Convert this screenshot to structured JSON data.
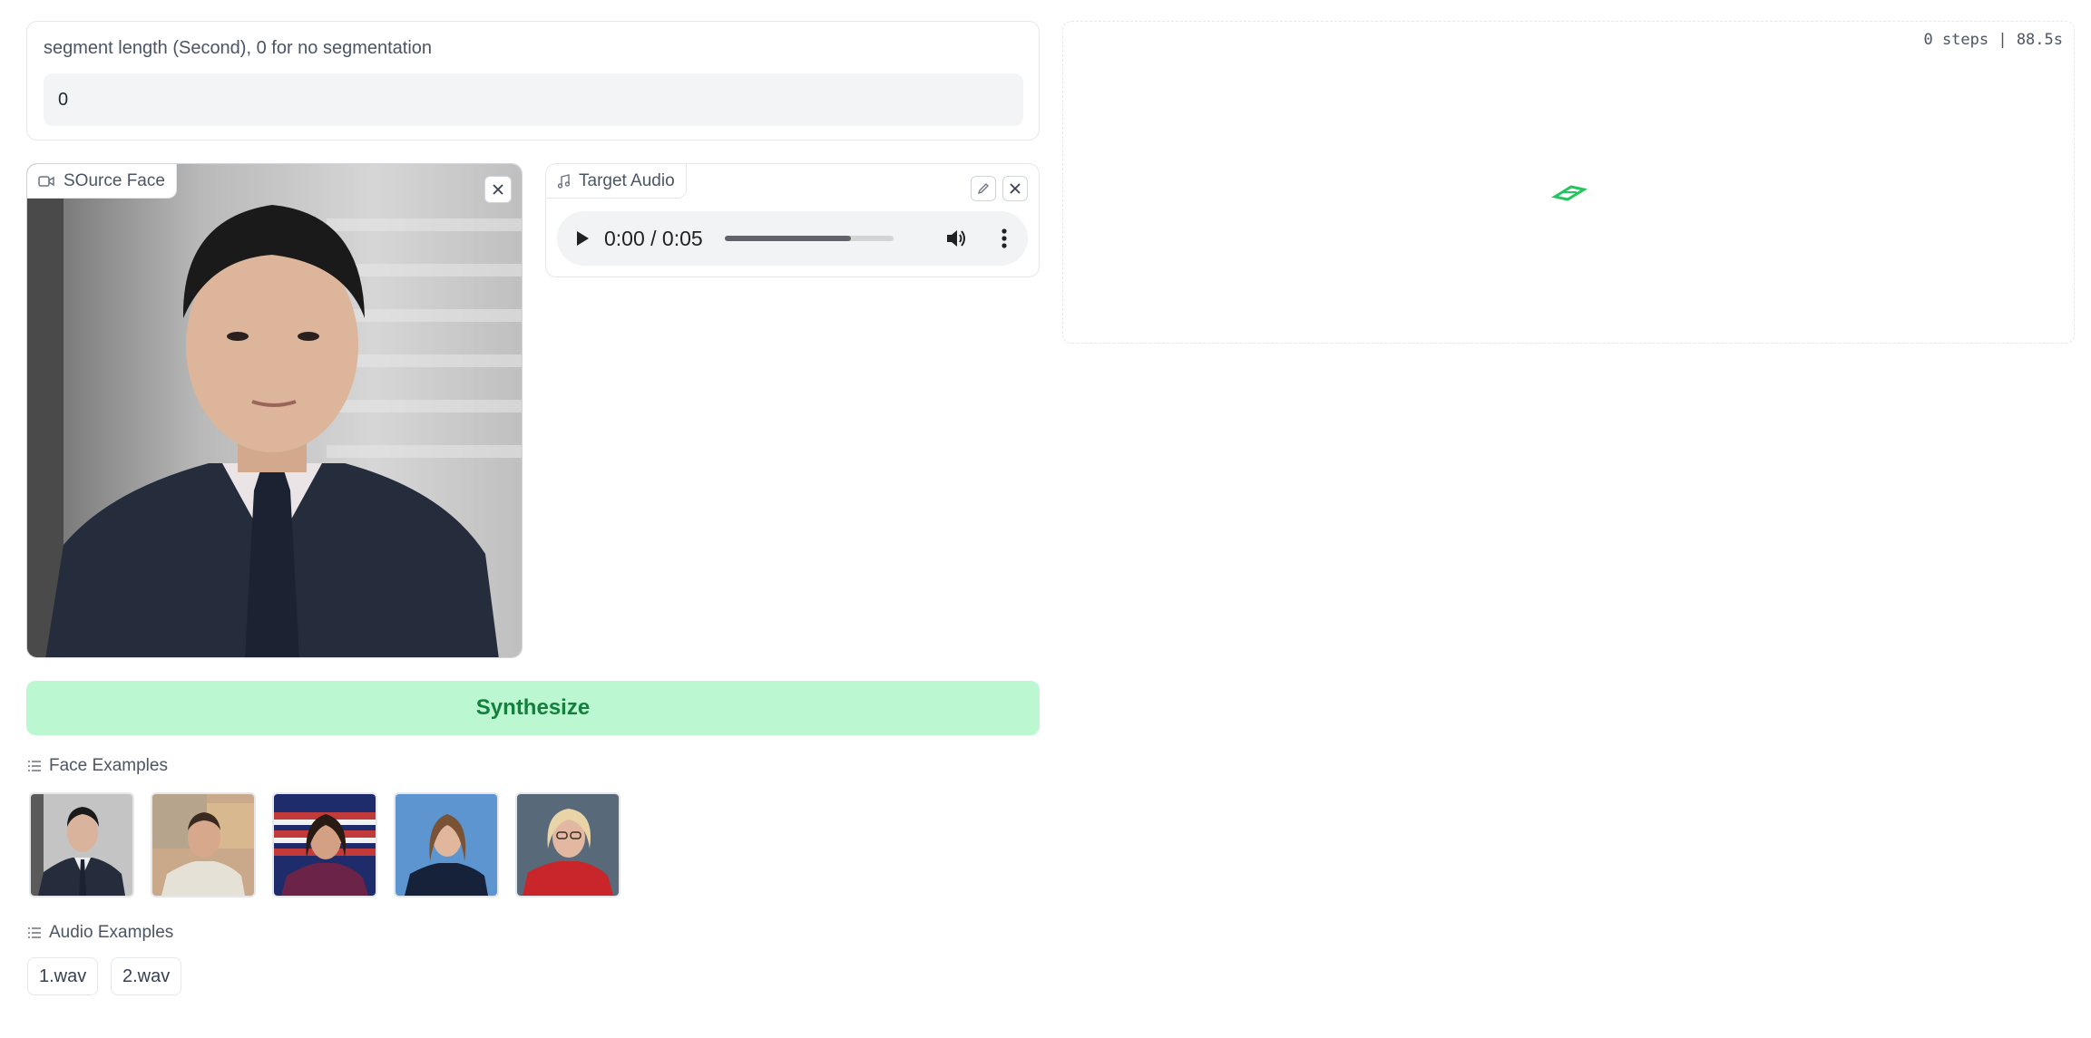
{
  "segment": {
    "label": "segment length (Second), 0 for no segmentation",
    "value": "0"
  },
  "source_face": {
    "label": "SOurce Face",
    "icon": "video-camera-icon",
    "close_icon": "close-icon"
  },
  "target_audio": {
    "label": "Target Audio",
    "icon": "music-note-icon",
    "time": "0:00 / 0:05",
    "progress": 0.75,
    "edit_icon": "pencil-icon",
    "close_icon": "close-icon",
    "play_icon": "play-icon",
    "volume_icon": "volume-icon",
    "more_icon": "more-vertical-icon"
  },
  "synthesize_label": "Synthesize",
  "face_examples": {
    "label": "Face Examples",
    "icon": "list-icon"
  },
  "audio_examples": {
    "label": "Audio Examples",
    "icon": "list-icon",
    "items": [
      "1.wav",
      "2.wav"
    ]
  },
  "output": {
    "status": "0 steps | 88.5s",
    "loader_icon": "loading-spinner-icon"
  },
  "colors": {
    "accent_green": "#bbf7d0",
    "accent_green_text": "#15803d"
  }
}
